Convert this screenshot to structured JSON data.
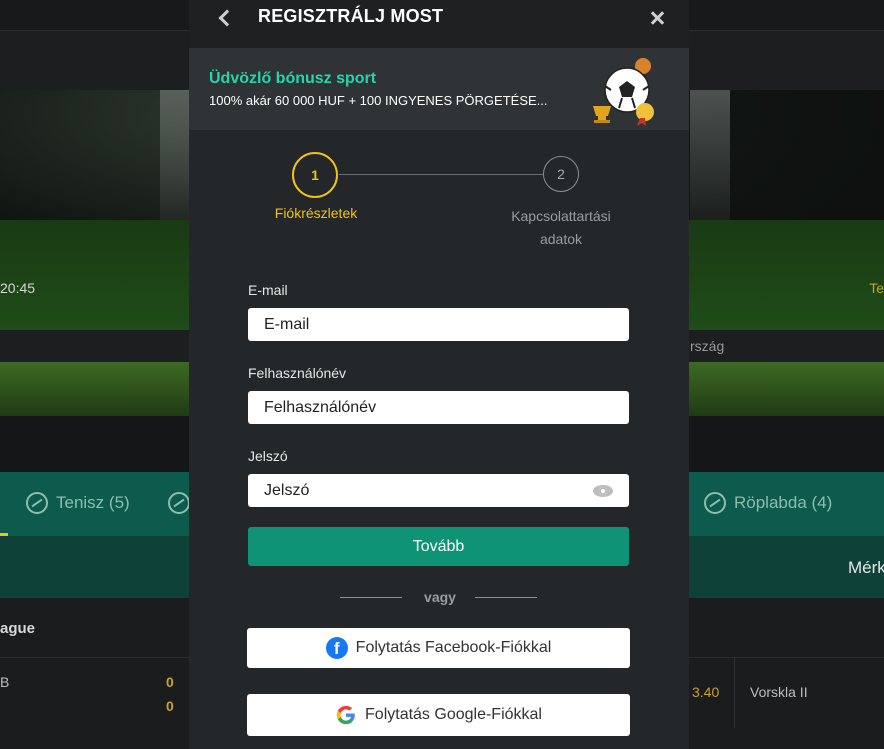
{
  "background": {
    "time": "20:45",
    "right_gold": "Te",
    "country": "rszág",
    "sports": [
      {
        "label": "Tenisz (5)"
      },
      {
        "label": "Röplabda (4)"
      }
    ],
    "sub_tab": "Mérk",
    "league": "ague",
    "row": {
      "left": "B",
      "score1": "0",
      "score2": "0",
      "odd": "3.40",
      "team": "Vorskla II"
    }
  },
  "modal": {
    "title": "REGISZTRÁLJ MOST",
    "bonus": {
      "title": "Üdvözlő bónusz sport",
      "subtitle": "100% akár 60 000 HUF + 100 INGYENES PÖRGETÉSE..."
    },
    "steps": [
      {
        "number": "1",
        "label": "Fiókrészletek"
      },
      {
        "number": "2",
        "label": "Kapcsolattartási adatok"
      }
    ],
    "form": {
      "email_label": "E-mail",
      "email_placeholder": "E-mail",
      "username_label": "Felhasználónév",
      "username_placeholder": "Felhasználónév",
      "password_label": "Jelszó",
      "password_placeholder": "Jelszó",
      "next_button": "Tovább",
      "or_text": "vagy",
      "facebook_button": "Folytatás Facebook-Fiókkal",
      "google_button": "Folytatás Google-Fiókkal"
    }
  },
  "colors": {
    "accent_yellow": "#f2c21b",
    "accent_green": "#0e9474",
    "bonus_title": "#25d6a8"
  }
}
